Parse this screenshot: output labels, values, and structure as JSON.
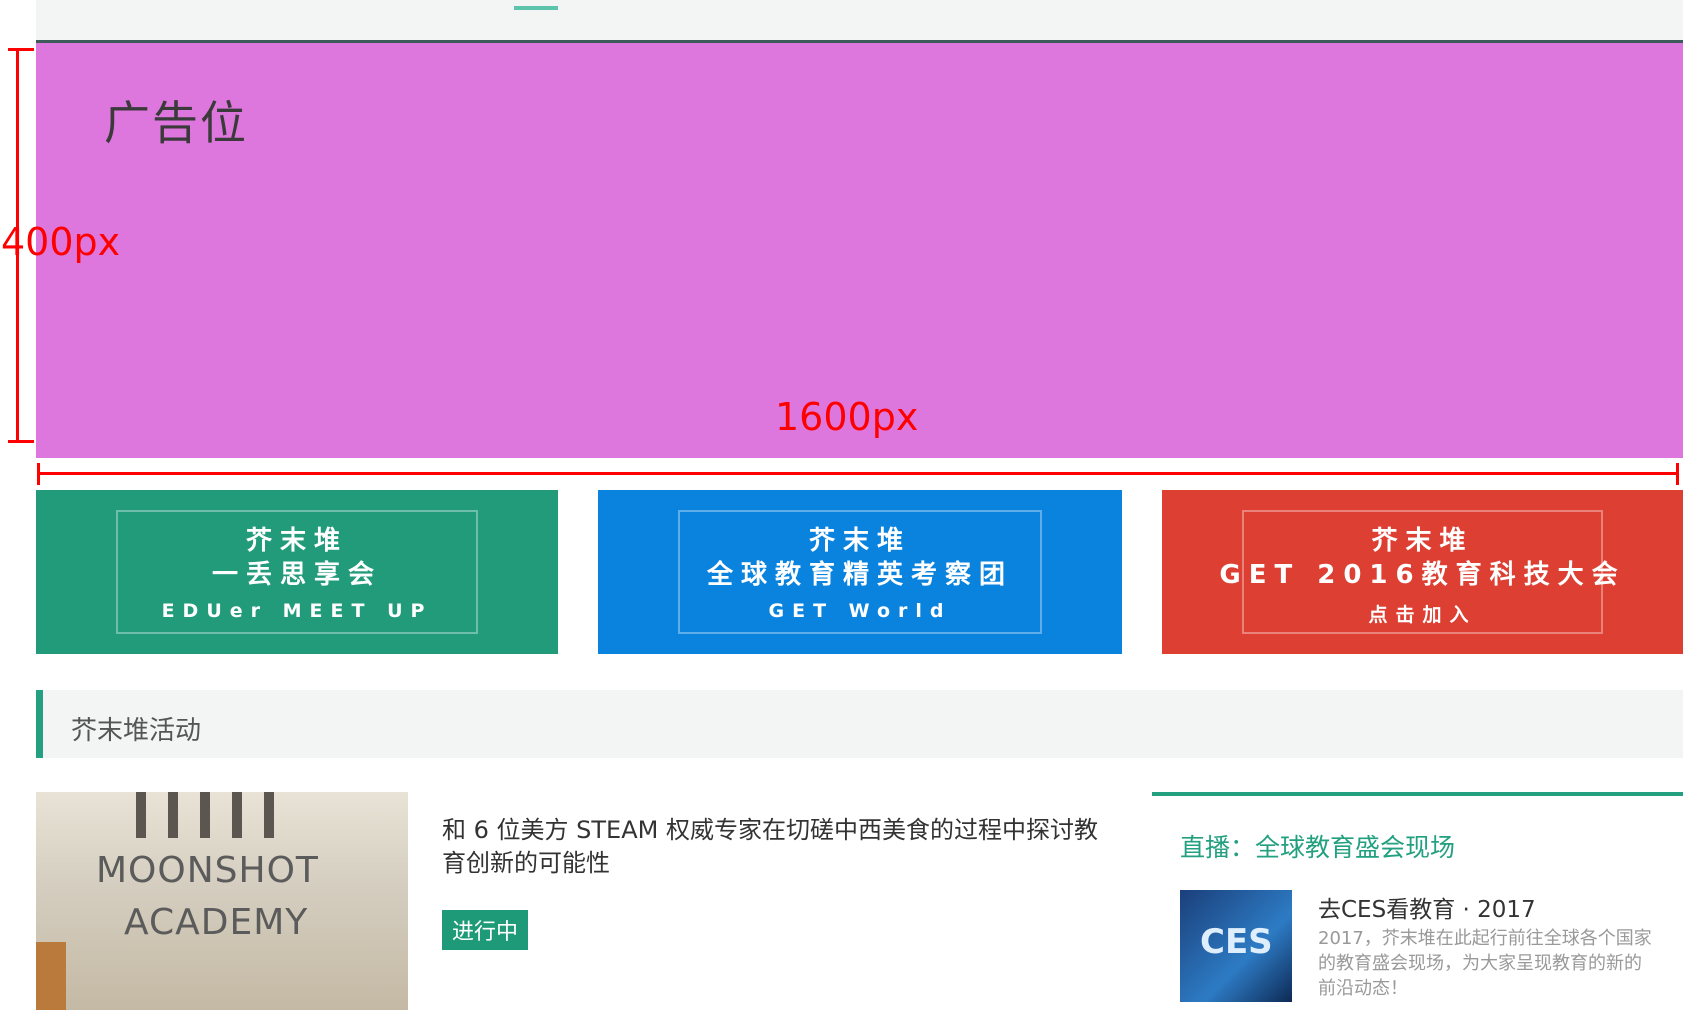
{
  "annotations": {
    "ad_label": "广告位",
    "height_label": "400px",
    "width_label": "1600px"
  },
  "banners": [
    {
      "line1": "芥末堆",
      "line2": "一丢思享会",
      "line3": "EDUer MEET UP",
      "color": "#229b7b"
    },
    {
      "line1": "芥末堆",
      "line2": "全球教育精英考察团",
      "line3": "GET World",
      "color": "#0a83df"
    },
    {
      "line1": "芥末堆",
      "line2": "GET 2016教育科技大会",
      "line3": "点击加入",
      "color": "#dd3f32"
    }
  ],
  "section": {
    "title": "芥末堆活动"
  },
  "activity": {
    "image_text_line1": "MOONSHOT",
    "image_text_line2": "ACADEMY",
    "title": "和 6 位美方 STEAM 权威专家在切磋中西美食的过程中探讨教育创新的可能性",
    "status": "进行中"
  },
  "live": {
    "heading": "直播：全球教育盛会现场",
    "thumb_text": "CES",
    "item_title": "去CES看教育 · 2017",
    "item_desc": "2017，芥末堆在此起行前往全球各个国家的教育盛会现场，为大家呈现教育的新的前沿动态！"
  },
  "colors": {
    "accent": "#22a080",
    "ad_bg": "#dd77dd",
    "annotation": "#ff0000"
  }
}
